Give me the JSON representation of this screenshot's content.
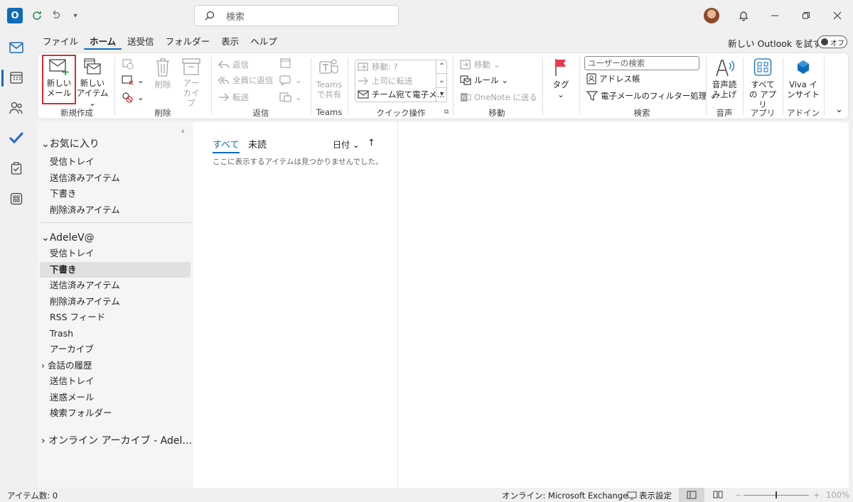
{
  "titlebar": {
    "app_logo": "O",
    "search_placeholder": "検索"
  },
  "tabs": [
    "ファイル",
    "ホーム",
    "送受信",
    "フォルダー",
    "表示",
    "ヘルプ"
  ],
  "try_new": "新しい Outlook を試す",
  "toggle_label": "オフ",
  "ribbon": {
    "new_mail": [
      "新しい",
      "メール"
    ],
    "new_item": [
      "新しい",
      "アイテム"
    ],
    "delete": "削除",
    "archive": [
      "アー",
      "カイブ"
    ],
    "reply": "返信",
    "reply_all": "全員に返信",
    "forward": "転送",
    "teams_share": [
      "Teams",
      "で共有"
    ],
    "qs_move": "移動: ?",
    "qs_manager": "上司に転送",
    "qs_team_email": "チーム宛て電子メ...",
    "move": "移動",
    "rules": "ルール",
    "onenote": "OneNote に送る",
    "tags": "タグ",
    "user_search_placeholder": "ユーザーの検索",
    "address_book": "アドレス帳",
    "filter_email": "電子メールのフィルター処理",
    "read_aloud": [
      "音声読",
      "み上げ"
    ],
    "all_apps": [
      "すべて",
      "の アプリ"
    ],
    "viva": [
      "Viva イ",
      "ンサイト"
    ],
    "groups": {
      "new": "新規作成",
      "delete": "削除",
      "respond": "返信",
      "teams": "Teams",
      "quick_steps": "クイック操作",
      "move": "移動",
      "find": "検索",
      "speech": "音声",
      "apps": "アプリ",
      "addins": "アドイン"
    }
  },
  "folders": {
    "favorites_head": "お気に入り",
    "favorites": [
      "受信トレイ",
      "送信済みアイテム",
      "下書き",
      "削除済みアイテム"
    ],
    "account_head": "AdeleV@",
    "account_items": [
      "受信トレイ",
      "下書き",
      "送信済みアイテム",
      "削除済みアイテム",
      "RSS フィード",
      "Trash",
      "アーカイブ"
    ],
    "conversation_history": "会話の履歴",
    "account_items2": [
      "送信トレイ",
      "迷惑メール",
      "検索フォルダー"
    ],
    "online_archive": "オンライン アーカイブ - Adel…"
  },
  "list": {
    "filter_all": "すべて",
    "filter_unread": "未読",
    "sort_by": "日付",
    "empty_message": "ここに表示するアイテムは見つかりませんでした。"
  },
  "status": {
    "item_count": "アイテム数: 0",
    "connection": "オンライン: Microsoft Exchange",
    "display_settings": "表示設定",
    "zoom": "100%"
  },
  "colors": {
    "accent": "#0f6cbd",
    "highlight": "#d32f2f"
  }
}
